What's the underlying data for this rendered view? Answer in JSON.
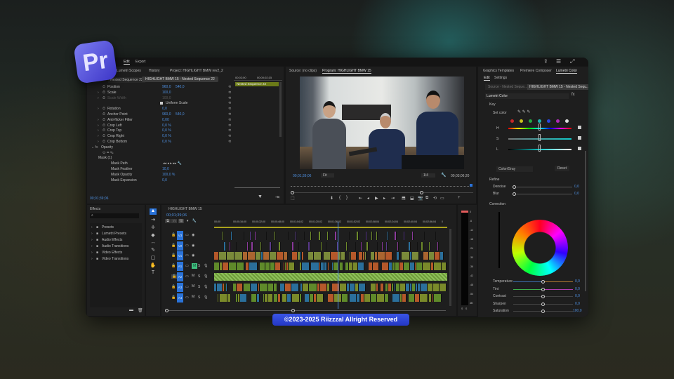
{
  "app": {
    "logo_text": "Pr",
    "menu": [
      "Edit",
      "Export"
    ]
  },
  "effect_controls": {
    "tabs": [
      "Lumetri Scopes",
      "History",
      "Project: HIGHLIGHT BMW rev2_2"
    ],
    "source_tab": "Nested Sequence 22",
    "clip_tab": "HIGHLIGHT BMW 15 - Nested Sequence 22",
    "mini_ruler": [
      "00;02;00",
      "00;00;02;15"
    ],
    "mini_clip": "Nested Sequence 22",
    "properties": [
      {
        "name": "Position",
        "v1": "960,0",
        "v2": "540,0",
        "expand": false
      },
      {
        "name": "Scale",
        "v1": "100,0",
        "v2": "",
        "expand": true
      },
      {
        "name": "Scale Width",
        "v1": "100,0",
        "v2": "",
        "expand": true,
        "disabled": true
      },
      {
        "name": "Uniform Scale",
        "v1": "",
        "v2": "",
        "checkbox": true
      },
      {
        "name": "Rotation",
        "v1": "0,0",
        "v2": "",
        "expand": true
      },
      {
        "name": "Anchor Point",
        "v1": "960,0",
        "v2": "540,0",
        "expand": false
      },
      {
        "name": "Anti-flicker Filter",
        "v1": "0,00",
        "v2": "",
        "expand": true
      },
      {
        "name": "Crop Left",
        "v1": "0,0 %",
        "v2": "",
        "expand": true
      },
      {
        "name": "Crop Top",
        "v1": "0,0 %",
        "v2": "",
        "expand": true
      },
      {
        "name": "Crop Right",
        "v1": "0,0 %",
        "v2": "",
        "expand": true
      },
      {
        "name": "Crop Bottom",
        "v1": "0,0 %",
        "v2": "",
        "expand": true
      }
    ],
    "opacity_label": "Opacity",
    "mask_label": "Mask (1)",
    "mask_props": [
      {
        "name": "Mask Path",
        "v1": ""
      },
      {
        "name": "Mask Feather",
        "v1": "10,0"
      },
      {
        "name": "Mask Opacity",
        "v1": "100,0 %"
      },
      {
        "name": "Mask Expansion",
        "v1": "0,0"
      }
    ],
    "timecode": "00;01;39;06"
  },
  "program": {
    "source_tab": "Source: (no clips)",
    "program_tab": "Program: HIGHLIGHT BMW 15",
    "timecode": "00;01;39;06",
    "fit": "Fit",
    "resolution": "1/4",
    "duration": "00;03;06;20",
    "playhead_fraction": 0.53
  },
  "lumetri": {
    "tabs": [
      "Graphics Templates",
      "Premiere Composer",
      "Lumetri Color"
    ],
    "subtabs": [
      "Edit",
      "Settings"
    ],
    "source_tab": "Source - Nested Seque...",
    "clip_tab": "HIGHLIGHT BMW 15 - Nested Sequ...",
    "effect": "Lumetri Color",
    "key_label": "Key",
    "set_color": "Set color",
    "swatches": [
      "#c62828",
      "#c9c21e",
      "#22a842",
      "#1fb3b3",
      "#2a45e0",
      "#b02ab8",
      "#dddddd"
    ],
    "hsl": [
      "H",
      "S",
      "L"
    ],
    "mode": "Color/Gray",
    "reset": "Reset",
    "refine_label": "Refine",
    "refine": [
      {
        "name": "Denoise",
        "value": "0,0"
      },
      {
        "name": "Blur",
        "value": "0,0"
      }
    ],
    "correction_label": "Correction",
    "correction": [
      {
        "name": "Temperature",
        "value": "0,0",
        "pos": 0.5
      },
      {
        "name": "Tint",
        "value": "0,0",
        "pos": 0.5
      },
      {
        "name": "Contrast",
        "value": "0,0",
        "pos": 0.5
      },
      {
        "name": "Sharpen",
        "value": "0,0",
        "pos": 0.5
      },
      {
        "name": "Saturation",
        "value": "100,0",
        "pos": 0.5
      }
    ]
  },
  "effects": {
    "title": "Effects",
    "search_placeholder": "",
    "folders": [
      "Presets",
      "Lumetri Presets",
      "Audio Effects",
      "Audio Transitions",
      "Video Effects",
      "Video Transitions"
    ]
  },
  "timeline": {
    "title": "HIGHLIGHT BMW 15",
    "timecode": "00;01;39;06",
    "ruler": [
      "00;00",
      "00;00;16;00",
      "00;00;32;00",
      "00;00;48;00",
      "00;01;04;02",
      "00;01;20;02",
      "00;01;36;02",
      "00;01;52;02",
      "00;02;08;04",
      "00;02;24;04",
      "00;02;40;04",
      "00;02;56;04",
      "0"
    ],
    "playhead_fraction": 0.53,
    "tracks": [
      {
        "name": "V3",
        "type": "video"
      },
      {
        "name": "V2",
        "type": "video"
      },
      {
        "name": "V1",
        "type": "video"
      },
      {
        "name": "A1",
        "type": "audio"
      },
      {
        "name": "A2",
        "type": "audio",
        "locked": true
      },
      {
        "name": "A3",
        "type": "audio"
      },
      {
        "name": "A4",
        "type": "audio"
      }
    ],
    "m_label": "M",
    "s_label": "S"
  },
  "meter": {
    "scale": [
      "0",
      "-6",
      "-12",
      "-18",
      "-24",
      "-30",
      "-36",
      "-42",
      "-48",
      "-54",
      "dB"
    ],
    "channels": [
      "S",
      "S"
    ]
  },
  "footer": {
    "copyright": "©2023-2025 Riizzzal Allright Reserved"
  },
  "colors": {
    "accent": "#2a73d9",
    "timecode": "#4e8fdf",
    "clip_orange": "#b5582a",
    "clip_green": "#6d8a2a",
    "clip_blue": "#2b6f9b"
  }
}
